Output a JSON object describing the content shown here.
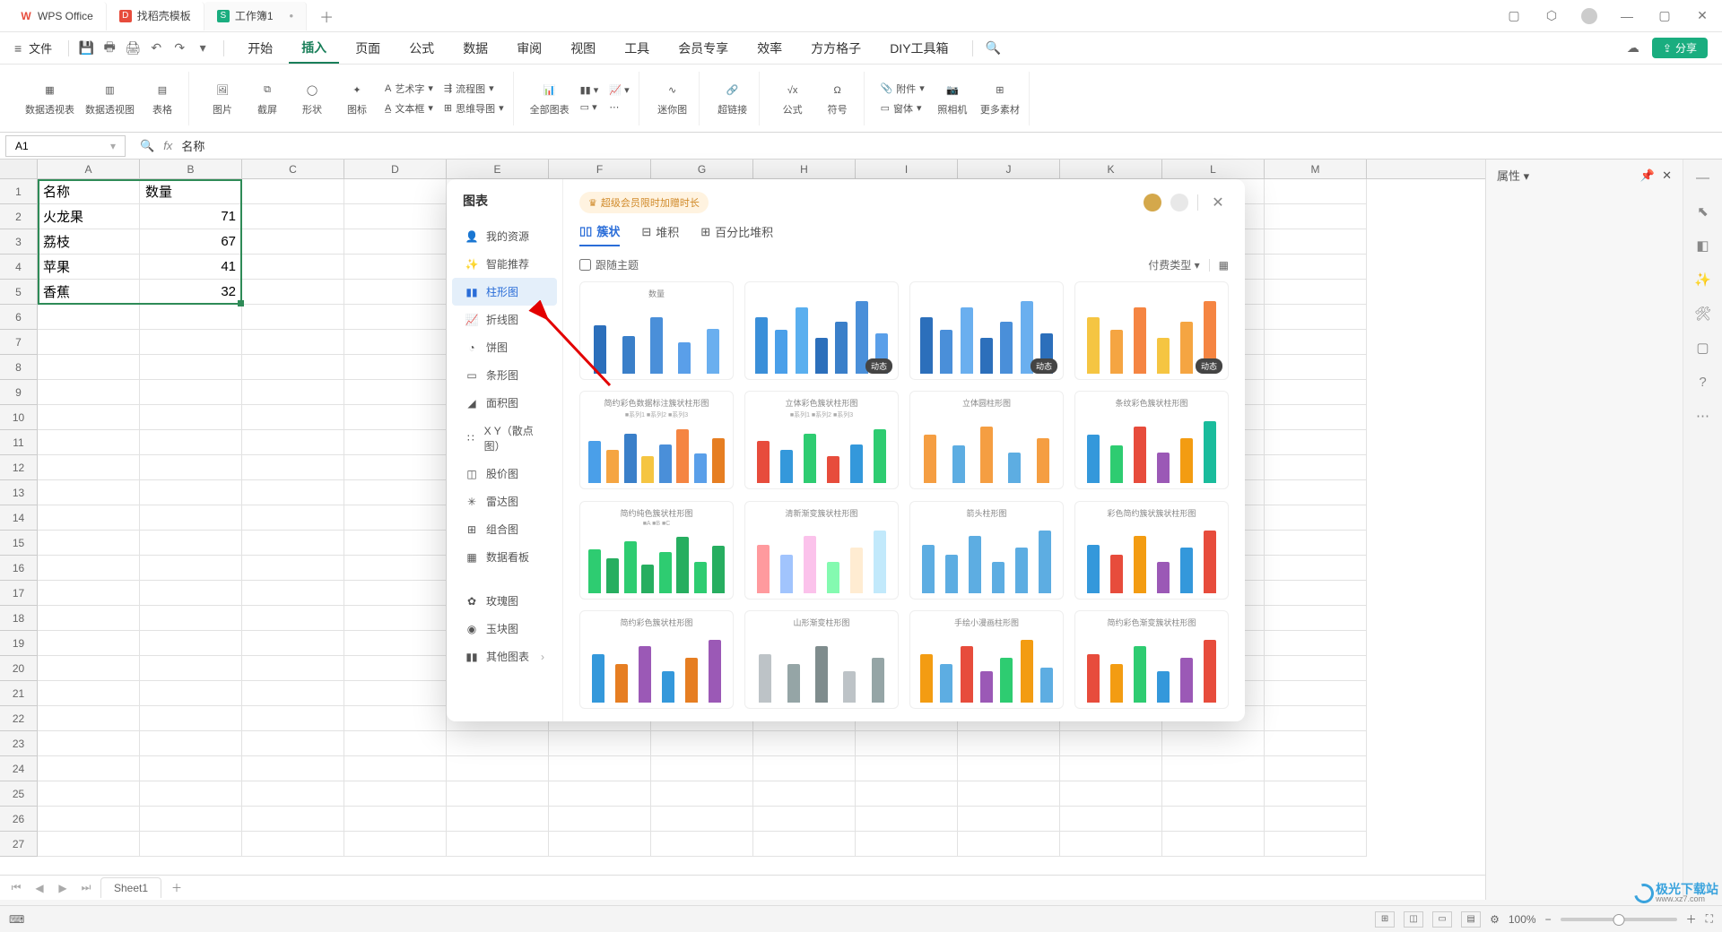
{
  "chart_data": {
    "type": "table",
    "columns": [
      "名称",
      "数量"
    ],
    "rows": [
      [
        "火龙果",
        71
      ],
      [
        "荔枝",
        67
      ],
      [
        "苹果",
        41
      ],
      [
        "香蕉",
        32
      ]
    ]
  },
  "titlebar": {
    "tab1": "WPS Office",
    "tab2": "找稻壳模板",
    "tab3": "工作簿1",
    "tab3_badge": "S"
  },
  "menu": {
    "file": "文件",
    "tabs": [
      "开始",
      "插入",
      "页面",
      "公式",
      "数据",
      "审阅",
      "视图",
      "工具",
      "会员专享",
      "效率",
      "方方格子",
      "DIY工具箱"
    ],
    "active": 1,
    "share": "分享"
  },
  "ribbon": {
    "pivot_table": "数据透视表",
    "pivot_chart": "数据透视图",
    "table": "表格",
    "picture": "图片",
    "screenshot": "截屏",
    "shape": "形状",
    "icon": "图标",
    "wordart": "艺术字",
    "textbox": "文本框",
    "flowchart": "流程图",
    "mindmap": "思维导图",
    "all_charts": "全部图表",
    "sparkline": "迷你图",
    "hyperlink": "超链接",
    "equation": "公式",
    "symbol": "符号",
    "attachment": "附件",
    "form": "窗体",
    "camera": "照相机",
    "more": "更多素材"
  },
  "namebox": "A1",
  "formula": "名称",
  "columns": [
    "A",
    "B",
    "C",
    "D",
    "E",
    "F",
    "G",
    "H",
    "I",
    "J",
    "K",
    "L",
    "M"
  ],
  "rightpane": {
    "title": "属性"
  },
  "dialog": {
    "title": "图表",
    "promo": "超级会员限时加赠时长",
    "side": {
      "resources": "我的资源",
      "smart": "智能推荐",
      "column": "柱形图",
      "line": "折线图",
      "pie": "饼图",
      "bar": "条形图",
      "area": "面积图",
      "scatter": "X Y（散点图）",
      "stock": "股价图",
      "radar": "雷达图",
      "combo": "组合图",
      "dashboard": "数据看板",
      "rose": "玫瑰图",
      "jade": "玉块图",
      "other": "其他图表"
    },
    "subtabs": {
      "cluster": "簇状",
      "stack": "堆积",
      "pct": "百分比堆积"
    },
    "follow_theme": "跟随主题",
    "pay_filter": "付费类型",
    "dynamic": "动态",
    "thumbs": [
      {
        "title": "数量",
        "legend": ""
      },
      {
        "title": "",
        "legend": ""
      },
      {
        "title": "",
        "legend": ""
      },
      {
        "title": "",
        "legend": ""
      },
      {
        "title": "简约彩色数据标注簇状柱形图",
        "legend": "■系列1 ■系列2 ■系列3"
      },
      {
        "title": "立体彩色簇状柱形图",
        "legend": "■系列1 ■系列2 ■系列3"
      },
      {
        "title": "立体圆柱形图",
        "legend": ""
      },
      {
        "title": "条纹彩色簇状柱形图",
        "legend": ""
      },
      {
        "title": "简约纯色簇状柱形图",
        "legend": "■A ■B ■C"
      },
      {
        "title": "清新渐变簇状柱形图",
        "legend": ""
      },
      {
        "title": "箭头柱形图",
        "legend": ""
      },
      {
        "title": "彩色简约簇状簇状柱形图",
        "legend": ""
      },
      {
        "title": "简约彩色簇状柱形图",
        "legend": ""
      },
      {
        "title": "山形渐变柱形图",
        "legend": ""
      },
      {
        "title": "手绘小漫画柱形图",
        "legend": ""
      },
      {
        "title": "简约彩色渐变簇状柱形图",
        "legend": ""
      }
    ]
  },
  "sheet": {
    "name": "Sheet1"
  },
  "status": {
    "zoom": "100%"
  },
  "watermark": "极光下载站",
  "watermark_url": "www.xz7.com"
}
